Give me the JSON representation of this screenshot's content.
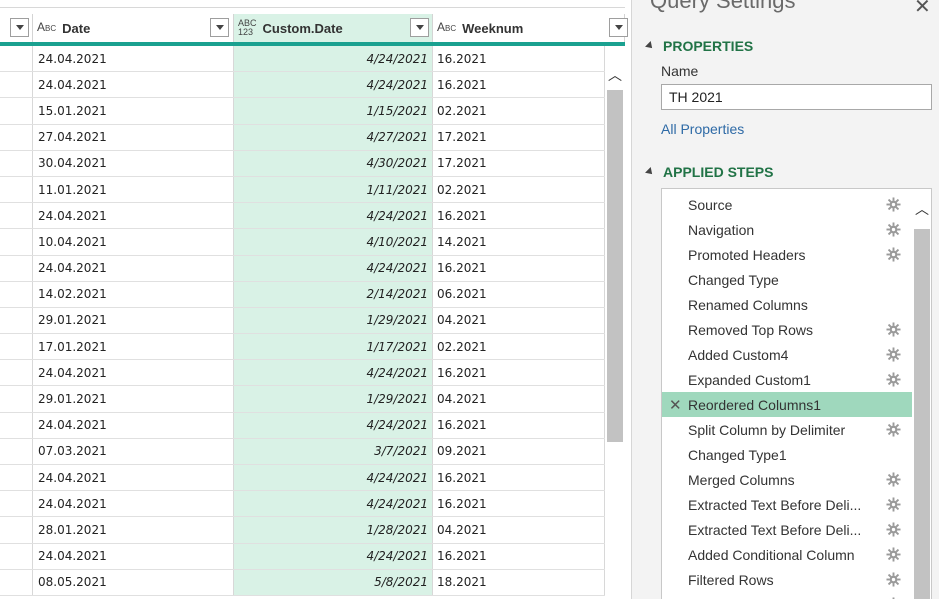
{
  "grid": {
    "columns": [
      {
        "type_icon": "ABC",
        "name": "Date"
      },
      {
        "type_icon": "ABC 123",
        "name": "Custom.Date"
      },
      {
        "type_icon": "ABC",
        "name": "Weeknum"
      }
    ],
    "rows": [
      [
        "24.04.2021",
        "4/24/2021",
        "16.2021"
      ],
      [
        "24.04.2021",
        "4/24/2021",
        "16.2021"
      ],
      [
        "15.01.2021",
        "1/15/2021",
        "02.2021"
      ],
      [
        "27.04.2021",
        "4/27/2021",
        "17.2021"
      ],
      [
        "30.04.2021",
        "4/30/2021",
        "17.2021"
      ],
      [
        "11.01.2021",
        "1/11/2021",
        "02.2021"
      ],
      [
        "24.04.2021",
        "4/24/2021",
        "16.2021"
      ],
      [
        "10.04.2021",
        "4/10/2021",
        "14.2021"
      ],
      [
        "24.04.2021",
        "4/24/2021",
        "16.2021"
      ],
      [
        "14.02.2021",
        "2/14/2021",
        "06.2021"
      ],
      [
        "29.01.2021",
        "1/29/2021",
        "04.2021"
      ],
      [
        "17.01.2021",
        "1/17/2021",
        "02.2021"
      ],
      [
        "24.04.2021",
        "4/24/2021",
        "16.2021"
      ],
      [
        "29.01.2021",
        "1/29/2021",
        "04.2021"
      ],
      [
        "24.04.2021",
        "4/24/2021",
        "16.2021"
      ],
      [
        "07.03.2021",
        "3/7/2021",
        "09.2021"
      ],
      [
        "24.04.2021",
        "4/24/2021",
        "16.2021"
      ],
      [
        "24.04.2021",
        "4/24/2021",
        "16.2021"
      ],
      [
        "28.01.2021",
        "1/28/2021",
        "04.2021"
      ],
      [
        "24.04.2021",
        "4/24/2021",
        "16.2021"
      ],
      [
        "08.05.2021",
        "5/8/2021",
        "18.2021"
      ]
    ]
  },
  "pane": {
    "title": "Query Settings",
    "close_glyph": "✕",
    "properties_heading": "PROPERTIES",
    "name_label": "Name",
    "name_value": "TH 2021",
    "all_properties_link": "All Properties",
    "applied_steps_heading": "APPLIED STEPS",
    "steps": [
      {
        "label": "Source",
        "gear": true,
        "selected": false
      },
      {
        "label": "Navigation",
        "gear": true,
        "selected": false
      },
      {
        "label": "Promoted Headers",
        "gear": true,
        "selected": false
      },
      {
        "label": "Changed Type",
        "gear": false,
        "selected": false
      },
      {
        "label": "Renamed Columns",
        "gear": false,
        "selected": false
      },
      {
        "label": "Removed Top Rows",
        "gear": true,
        "selected": false
      },
      {
        "label": "Added Custom4",
        "gear": true,
        "selected": false
      },
      {
        "label": "Expanded Custom1",
        "gear": true,
        "selected": false
      },
      {
        "label": "Reordered Columns1",
        "gear": false,
        "selected": true
      },
      {
        "label": "Split Column by Delimiter",
        "gear": true,
        "selected": false
      },
      {
        "label": "Changed Type1",
        "gear": false,
        "selected": false
      },
      {
        "label": "Merged Columns",
        "gear": true,
        "selected": false
      },
      {
        "label": "Extracted Text Before Deli...",
        "gear": true,
        "selected": false
      },
      {
        "label": "Extracted Text Before Deli...",
        "gear": true,
        "selected": false
      },
      {
        "label": "Added Conditional Column",
        "gear": true,
        "selected": false
      },
      {
        "label": "Filtered Rows",
        "gear": true,
        "selected": false
      },
      {
        "label": "Added Custom",
        "gear": true,
        "selected": false
      }
    ]
  },
  "colors": {
    "accent_teal": "#1aa190",
    "selected_column": "#d9f2e6",
    "selected_step": "#9fd8bd",
    "section_heading": "#217346",
    "link": "#2e6aa6"
  }
}
